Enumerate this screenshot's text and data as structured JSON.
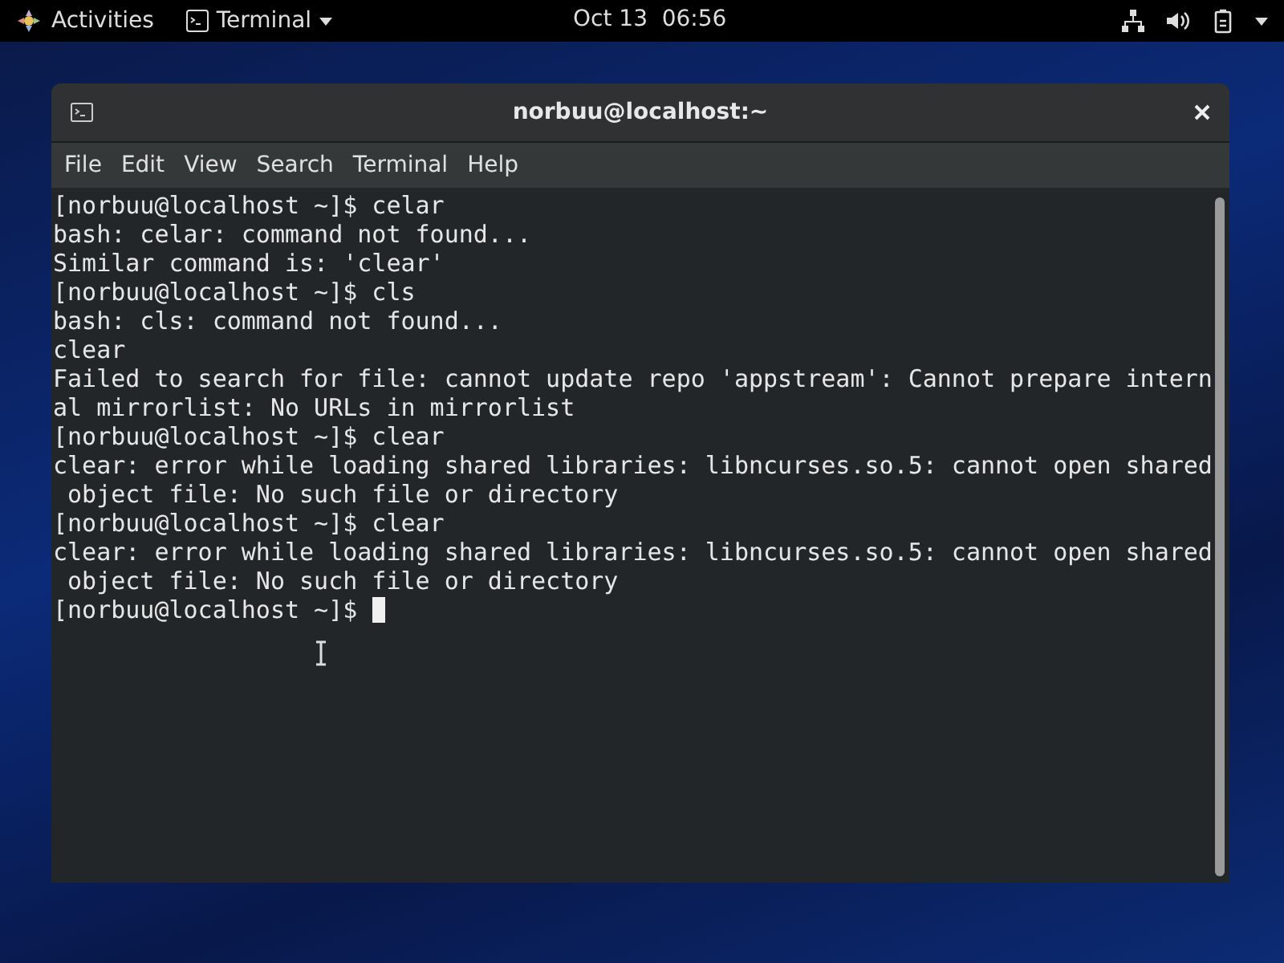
{
  "top_bar": {
    "activities": "Activities",
    "app_menu": "Terminal",
    "clock": "Oct 13  06:56"
  },
  "window": {
    "title": "norbuu@localhost:~"
  },
  "menu": [
    "File",
    "Edit",
    "View",
    "Search",
    "Terminal",
    "Help"
  ],
  "terminal": {
    "lines": [
      "[norbuu@localhost ~]$ celar",
      "bash: celar: command not found...",
      "Similar command is: 'clear'",
      "[norbuu@localhost ~]$ cls",
      "bash: cls: command not found...",
      "clear",
      "Failed to search for file: cannot update repo 'appstream': Cannot prepare intern",
      "al mirrorlist: No URLs in mirrorlist",
      "[norbuu@localhost ~]$ clear",
      "clear: error while loading shared libraries: libncurses.so.5: cannot open shared",
      " object file: No such file or directory",
      "[norbuu@localhost ~]$ clear",
      "clear: error while loading shared libraries: libncurses.so.5: cannot open shared",
      " object file: No such file or directory"
    ],
    "prompt": "[norbuu@localhost ~]$ "
  }
}
